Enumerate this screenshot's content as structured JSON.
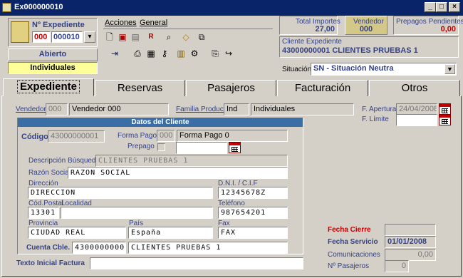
{
  "window": {
    "title": "Ex000000010"
  },
  "expediente": {
    "label": "Nº Expediente",
    "num1": "000",
    "num2": "000010",
    "status": "Abierto",
    "type": "Individuales"
  },
  "menu": {
    "acciones": "Acciones",
    "general": "General"
  },
  "totals": {
    "importes_label": "Total Importes",
    "importes_value": "27,00",
    "vendedor_label": "Vendedor",
    "vendedor_value": "000",
    "prepagos_label": "Prepagos Pendientes",
    "prepagos_value": "0,00"
  },
  "cliente": {
    "label": "Cliente Expediente",
    "value": "43000000001 CLIENTES PRUEBAS 1"
  },
  "situacion": {
    "label": "Situación",
    "value": "SN - Situación Neutra"
  },
  "tabs": [
    "Expediente",
    "Reservas",
    "Pasajeros",
    "Facturación",
    "Otros"
  ],
  "form": {
    "vendedor_label": "Vendedor",
    "vendedor_code": "000",
    "vendedor_name": "Vendedor 000",
    "familia_label": "Familia Producto",
    "familia_code": "Ind",
    "familia_name": "Individuales",
    "f_apertura_label": "F. Apertura",
    "f_apertura_value": "24/04/2008",
    "f_limite_label": "F. Límite",
    "f_limite_value": "",
    "datos_cliente_title": "Datos del Cliente",
    "codigo_label": "Código",
    "codigo_value": "43000000001",
    "forma_pago_label": "Forma Pago",
    "forma_pago_code": "000",
    "forma_pago_name": "Forma Pago 0",
    "prepago_label": "Prepago",
    "descripcion_label": "Descripción Búsqueda",
    "descripcion_value": "CLIENTES PRUEBAS 1",
    "razon_label": "Razón Social",
    "razon_value": "RAZON SOCIAL",
    "direccion_label": "Dirección",
    "direccion_value": "DIRECCION",
    "dni_label": "D.N.I. / C.I.F",
    "dni_value": "12345678Z",
    "cp_label": "Cód.Postal",
    "cp_value": "13301",
    "localidad_label": "Localidad",
    "localidad_value": "",
    "telefono_label": "Teléfono",
    "telefono_value": "987654201",
    "provincia_label": "Provincia",
    "provincia_value": "CIUDAD REAL",
    "pais_label": "País",
    "pais_value": "España",
    "fax_label": "Fax",
    "fax_value": "FAX",
    "cuenta_label": "Cuenta Cble.",
    "cuenta_code": "43000000001",
    "cuenta_name": "CLIENTES PRUEBAS 1",
    "texto_label": "Texto Inicial Factura",
    "texto_value": "",
    "fecha_cierre_label": "Fecha Cierre",
    "fecha_cierre_value": "",
    "fecha_servicio_label": "Fecha Servicio",
    "fecha_servicio_value": "01/01/2008",
    "comunicaciones_label": "Comunicaciones",
    "comunicaciones_value": "0,00",
    "pasajeros_label": "Nº Pasajeros",
    "pasajeros_value": "0"
  },
  "colors": {
    "titlebar": "#0a246a",
    "highlight": "#ffff99",
    "accent_red": "#c00000",
    "section": "#3a6ea5"
  }
}
